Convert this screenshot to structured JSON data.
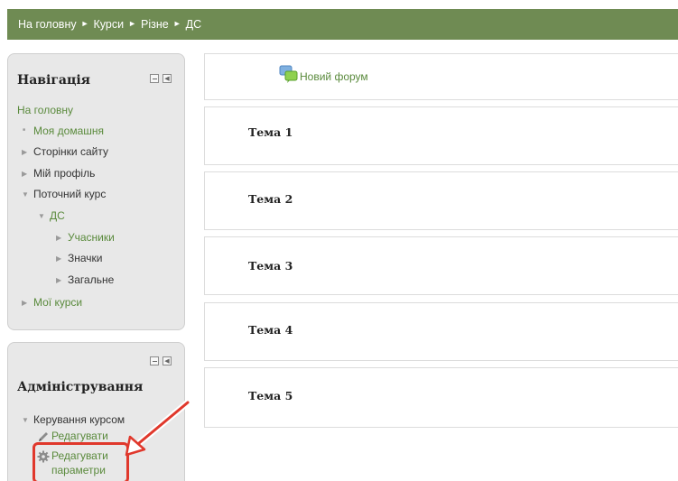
{
  "breadcrumb": {
    "items": [
      "На головну",
      "Курси",
      "Різне",
      "ДС"
    ],
    "separator": "►"
  },
  "navigation": {
    "title": "Навігація",
    "home": "На головну",
    "items": {
      "my_home": "Моя домашня",
      "site_pages": "Сторінки сайту",
      "my_profile": "Мій профіль",
      "current_course": "Поточний курс",
      "course": "ДС",
      "participants": "Учасники",
      "badges": "Значки",
      "general": "Загальне",
      "my_courses": "Мої курси"
    }
  },
  "administration": {
    "title": "Адміністрування",
    "course_admin": "Керування курсом",
    "edit": "Редагувати",
    "edit_settings_line1": "Редагувати",
    "edit_settings_line2": "параметри"
  },
  "main": {
    "forum_link": "Новий форум",
    "topics": [
      "Тема 1",
      "Тема 2",
      "Тема 3",
      "Тема 4",
      "Тема 5"
    ]
  },
  "colors": {
    "navbar": "#6f8b53",
    "link": "#5a8a3c",
    "highlight": "#e0382c"
  }
}
